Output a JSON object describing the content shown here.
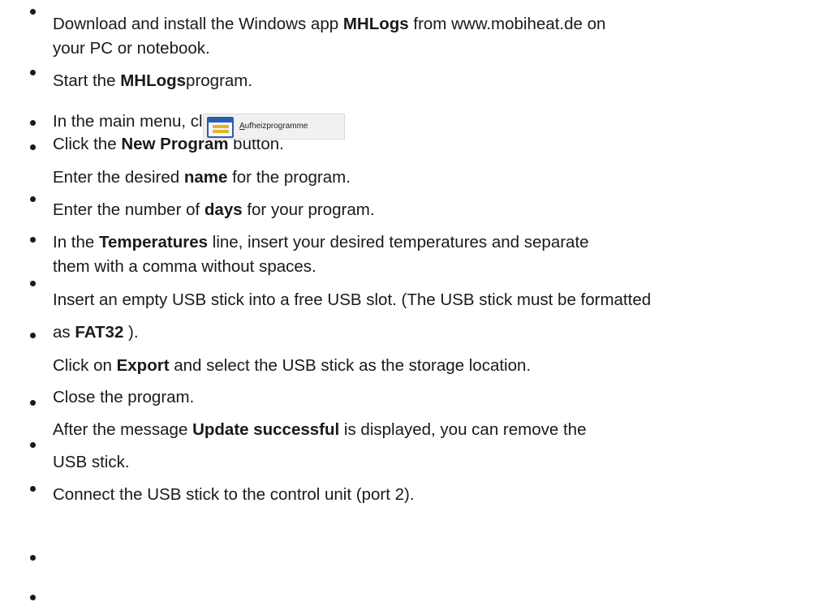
{
  "steps": {
    "s1": {
      "pre": "Download and install the Windows app ",
      "bold": "MHLogs",
      "post": " from www.mobiheat.de on"
    },
    "s1b": {
      "text": "your PC or notebook."
    },
    "s2": {
      "pre": "Start the ",
      "bold": "MHLogs",
      "post": "program."
    },
    "s3": {
      "text": "In the main menu, click on"
    },
    "s4": {
      "pre": "Click the ",
      "bold": "New Program",
      "post": " button."
    },
    "s5": {
      "pre": "Enter the desired ",
      "bold": "name",
      "post": " for the program."
    },
    "s6": {
      "pre": "Enter the number of ",
      "bold": "days",
      "post": " for your program."
    },
    "s7": {
      "pre": "In the ",
      "bold": "Temperatures",
      "post": " line, insert your desired temperatures and separate"
    },
    "s7b": {
      "text": "them with a comma without spaces."
    },
    "s8": {
      "text": "Insert an empty USB stick into a free USB slot. (The USB stick must be formatted"
    },
    "s8b": {
      "pre": "as ",
      "bold": "FAT32",
      "post": " )."
    },
    "s9": {
      "pre": "Click on ",
      "bold": "Export",
      "post": " and select the USB stick as the storage location."
    },
    "s10": {
      "text": "Close the program."
    },
    "s11": {
      "pre": "After the message ",
      "bold": "Update successful",
      "post": " is displayed, you can remove the"
    },
    "s11b": {
      "text": "USB stick."
    },
    "s12": {
      "text": "Connect the USB stick to the control unit (port 2)."
    }
  },
  "menu_button": {
    "icon": "program-list-window-icon",
    "label_first": "A",
    "label_rest": "ufheizprogramme"
  }
}
